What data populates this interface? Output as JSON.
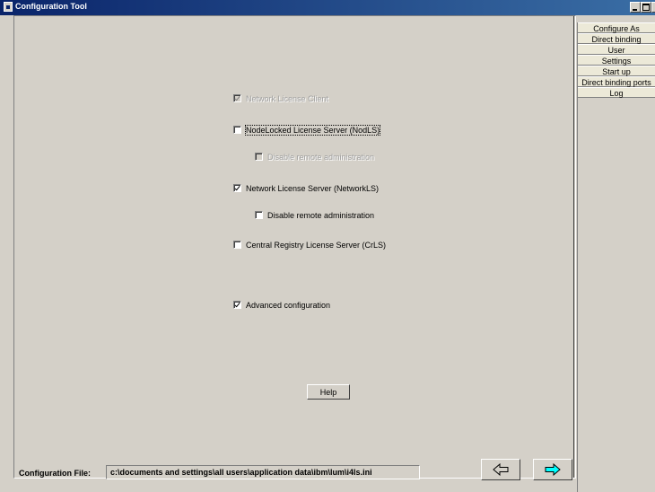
{
  "window": {
    "title": "Configuration Tool",
    "controls": [
      "minimize",
      "maximize",
      "close"
    ]
  },
  "options": {
    "network_license_client": {
      "label": "Network License Client",
      "checked": true,
      "enabled": false
    },
    "nodelocked_license_server": {
      "label": "NodeLocked License Server (NodLS)",
      "checked": false,
      "enabled": true,
      "focused": true
    },
    "nodls_disable_remote_admin": {
      "label": "Disable remote administration",
      "checked": false,
      "enabled": false
    },
    "network_license_server": {
      "label": "Network License Server (NetworkLS)",
      "checked": true,
      "enabled": true
    },
    "networkls_disable_remote_admin": {
      "label": "Disable remote administration",
      "checked": false,
      "enabled": true
    },
    "central_registry_license_server": {
      "label": "Central Registry License Server (CrLS)",
      "checked": false,
      "enabled": true
    },
    "advanced_configuration": {
      "label": "Advanced configuration",
      "checked": true,
      "enabled": true
    }
  },
  "help_button": {
    "label": "Help"
  },
  "config_file": {
    "label": "Configuration File:",
    "value": "c:\\documents and settings\\all users\\application data\\ibm\\lum\\i4ls.ini"
  },
  "navigation": {
    "back_icon": "left-arrow-outline-icon",
    "next_icon": "right-arrow-cyan-icon",
    "accent_next": "#00ffff"
  },
  "side_nav": {
    "items": [
      {
        "label": "Configure As"
      },
      {
        "label": "Direct binding"
      },
      {
        "label": "User"
      },
      {
        "label": "Settings"
      },
      {
        "label": "Start up"
      },
      {
        "label": "Direct binding ports"
      },
      {
        "label": "Log"
      }
    ]
  },
  "colors": {
    "titlebar_start": "#0a246a",
    "titlebar_end": "#3a6ea5",
    "face": "#d4d0c8"
  }
}
